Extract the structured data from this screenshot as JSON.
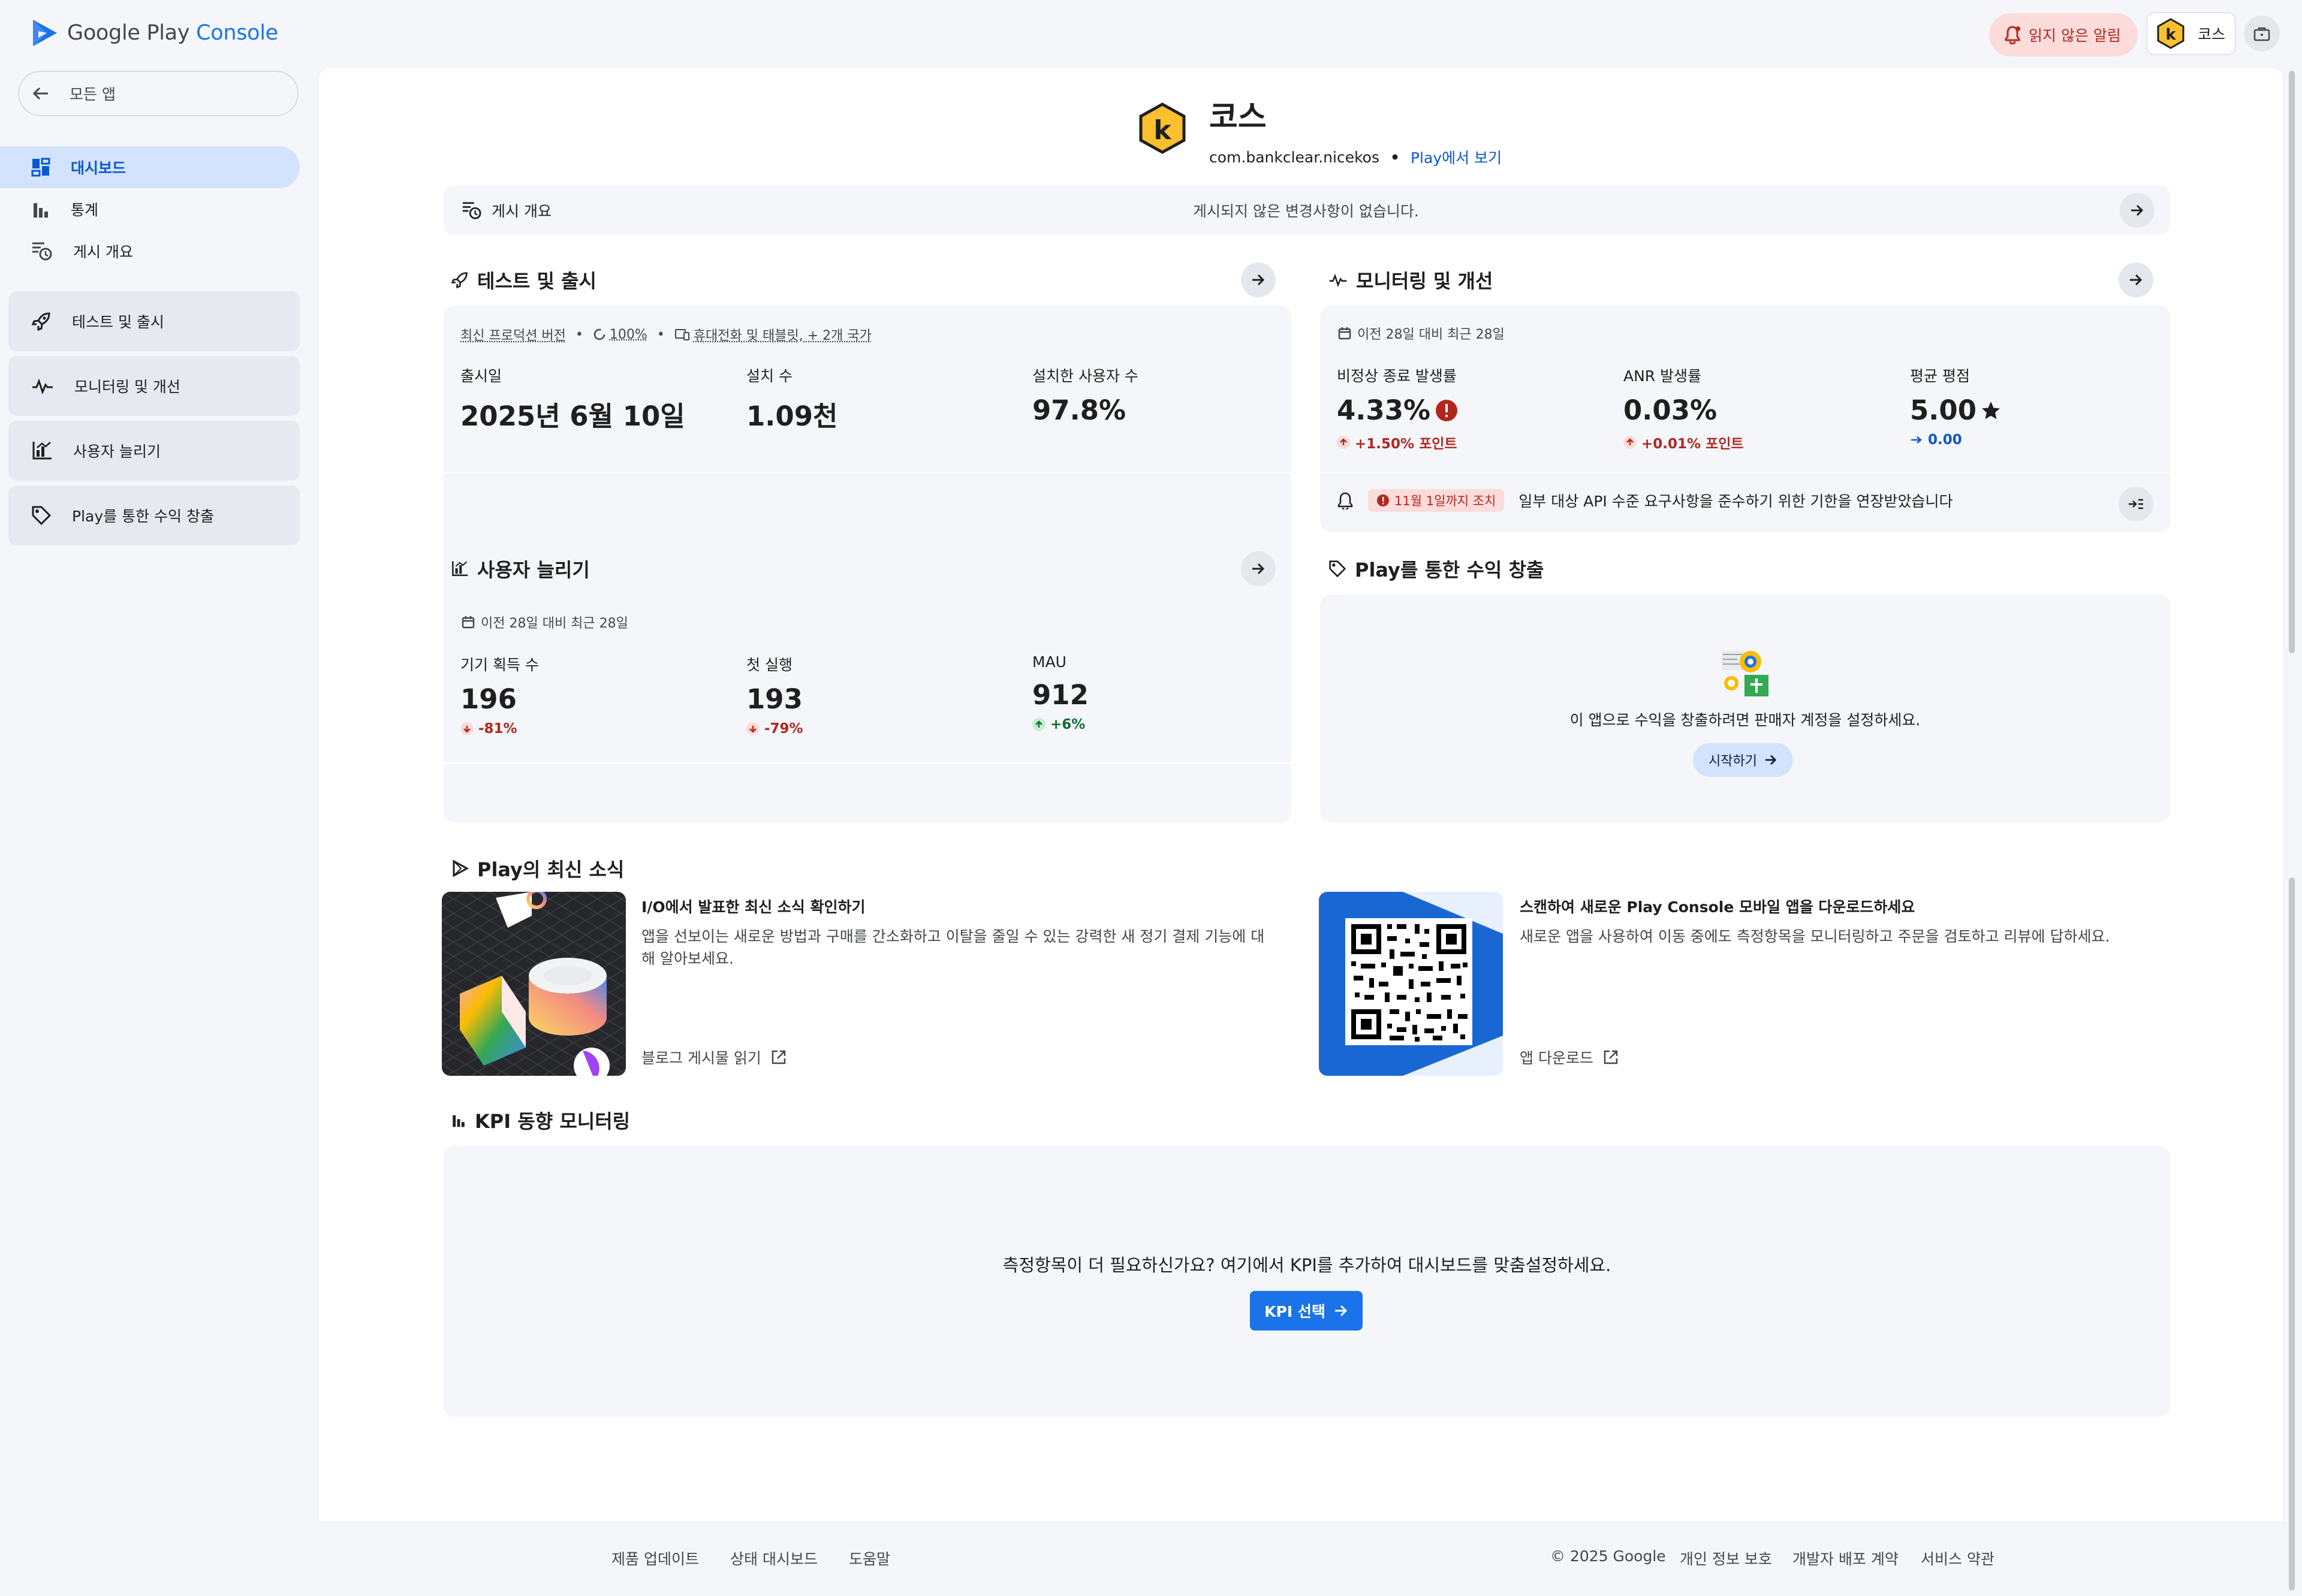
{
  "header": {
    "logo_text": "Google Play",
    "logo_console": "Console",
    "notifications_label": "읽지 않은 알림",
    "account_name": "코스"
  },
  "sidebar": {
    "back_label": "모든 앱",
    "items": [
      {
        "label": "대시보드",
        "icon": "dashboard-icon",
        "active": true
      },
      {
        "label": "통계",
        "icon": "bar-chart-icon"
      },
      {
        "label": "게시 개요",
        "icon": "publishing-overview-icon"
      }
    ],
    "cards": [
      {
        "label": "테스트 및 출시",
        "icon": "rocket-icon"
      },
      {
        "label": "모니터링 및 개선",
        "icon": "vitals-icon"
      },
      {
        "label": "사용자 늘리기",
        "icon": "grow-users-icon"
      },
      {
        "label": "Play를 통한 수익 창출",
        "icon": "tag-icon"
      }
    ]
  },
  "app": {
    "name": "코스",
    "package": "com.bankclear.nicekos",
    "separator": "•",
    "view_in_play": "Play에서 보기"
  },
  "publishing": {
    "title": "게시 개요",
    "message": "게시되지 않은 변경사항이 없습니다."
  },
  "test_release": {
    "title": "테스트 및 출시",
    "meta_version": "최신 프로덕션 버전",
    "meta_rollout": "100%",
    "meta_devices": "휴대전화 및 태블릿, + 2개 국가",
    "meta_sep": "•",
    "metrics": [
      {
        "label": "출시일",
        "value": "2025년 6월 10일"
      },
      {
        "label": "설치 수",
        "value": "1.09천"
      },
      {
        "label": "설치한 사용자 수",
        "value": "97.8%"
      }
    ]
  },
  "monitoring": {
    "title": "모니터링 및 개선",
    "period": "이전 28일 대비 최근 28일",
    "metrics": [
      {
        "label": "비정상 종료 발생률",
        "value": "4.33%",
        "delta": "+1.50% 포인트",
        "trend": "up-bad"
      },
      {
        "label": "ANR 발생률",
        "value": "0.03%",
        "delta": "+0.01% 포인트",
        "trend": "up-bad"
      },
      {
        "label": "평균 평점",
        "value": "5.00",
        "delta": "0.00",
        "trend": "flat"
      }
    ],
    "api_badge": "11월 1일까지 조치",
    "api_message": "일부 대상 API 수준 요구사항을 준수하기 위한 기한을 연장받았습니다"
  },
  "grow_users": {
    "title": "사용자 늘리기",
    "period": "이전 28일 대비 최근 28일",
    "metrics": [
      {
        "label": "기기 획득 수",
        "value": "196",
        "delta": "-81%",
        "trend": "down"
      },
      {
        "label": "첫 실행",
        "value": "193",
        "delta": "-79%",
        "trend": "down"
      },
      {
        "label": "MAU",
        "value": "912",
        "delta": "+6%",
        "trend": "up-good"
      }
    ]
  },
  "monetize": {
    "title": "Play를 통한 수익 창출",
    "message": "이 앱으로 수익을 창출하려면 판매자 계정을 설정하세요.",
    "button": "시작하기"
  },
  "news": {
    "title": "Play의 최신 소식",
    "items": [
      {
        "title": "I/O에서 발표한 최신 소식 확인하기",
        "desc": "앱을 선보이는 새로운 방법과 구매를 간소화하고 이탈을 줄일 수 있는 강력한 새 정기 결제 기능에 대해 알아보세요.",
        "link": "블로그 게시물 읽기"
      },
      {
        "title": "스캔하여 새로운 Play Console 모바일 앱을 다운로드하세요",
        "desc": "새로운 앱을 사용하여 이동 중에도 측정항목을 모니터링하고 주문을 검토하고 리뷰에 답하세요.",
        "link": "앱 다운로드"
      }
    ]
  },
  "kpi": {
    "title": "KPI 동향 모니터링",
    "message": "측정항목이 더 필요하신가요? 여기에서 KPI를 추가하여 대시보드를 맞춤설정하세요.",
    "button": "KPI 선택"
  },
  "footer": {
    "links_left": [
      "제품 업데이트",
      "상태 대시보드",
      "도움말"
    ],
    "copyright": "© 2025 Google",
    "links_right": [
      "개인 정보 보호",
      "개발자 배포 계약",
      "서비스 약관"
    ]
  },
  "colors": {
    "accent": "#1a73e8",
    "active_nav_bg": "#d3e3fd",
    "error": "#b3261e",
    "success": "#146c2e",
    "panel_bg": "#f4f6fa",
    "app_icon": "#fbc02d"
  }
}
